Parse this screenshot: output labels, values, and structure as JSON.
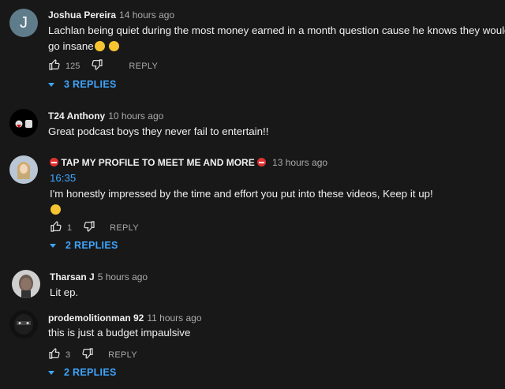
{
  "comments": [
    {
      "author": "Joshua Pereira",
      "avatar_letter": "J",
      "time": "14 hours ago",
      "line1": "Lachlan being quiet during the most money earned in a month question cause he knows they would",
      "line2": "go insane",
      "likes": "125",
      "reply_label": "REPLY",
      "replies_label": "3 REPLIES"
    },
    {
      "author": "T24 Anthony",
      "time": "10 hours ago",
      "line1": "Great podcast boys they never fail to entertain!!"
    },
    {
      "author": "TAP MY PROFILE TO MEET ME AND MORE",
      "time": "13 hours ago",
      "timestamp_link": "16:35",
      "line1": "I'm honestly impressed by the time and effort you put into these videos, Keep it up!",
      "likes": "1",
      "reply_label": "REPLY",
      "replies_label": "2 REPLIES"
    },
    {
      "author": "Tharsan J",
      "time": "5 hours ago",
      "line1": "Lit ep."
    },
    {
      "author": "prodemolitionman 92",
      "time": "11 hours ago",
      "line1": "this is just a budget impaulsive",
      "likes": "3",
      "reply_label": "REPLY",
      "replies_label": "2 REPLIES"
    }
  ],
  "colors": {
    "background": "#181818",
    "link": "#3ea6ff",
    "secondary": "#aaaaaa"
  },
  "icons": [
    "thumb-up-icon",
    "thumb-down-icon",
    "expand-triangle-icon",
    "no-entry-icon",
    "rofl-emoji-icon",
    "smile-emoji-icon"
  ]
}
